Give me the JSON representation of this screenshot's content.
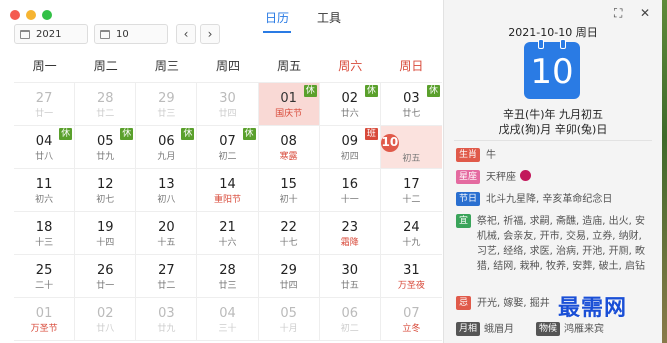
{
  "window": {
    "lights": [
      "#f45b50",
      "#f6b431",
      "#33c046"
    ]
  },
  "tabs": [
    {
      "label": "日历",
      "active": true
    },
    {
      "label": "工具",
      "active": false
    }
  ],
  "toolbar": {
    "year": "2021",
    "month": "10",
    "prev": "‹",
    "next": "›"
  },
  "weekdays": [
    {
      "label": "周一",
      "weekend": false
    },
    {
      "label": "周二",
      "weekend": false
    },
    {
      "label": "周三",
      "weekend": false
    },
    {
      "label": "周四",
      "weekend": false
    },
    {
      "label": "周五",
      "weekend": false
    },
    {
      "label": "周六",
      "weekend": true
    },
    {
      "label": "周日",
      "weekend": true
    }
  ],
  "days": [
    {
      "d": "27",
      "l": "廿一",
      "other": true
    },
    {
      "d": "28",
      "l": "廿二",
      "other": true
    },
    {
      "d": "29",
      "l": "廿三",
      "other": true
    },
    {
      "d": "30",
      "l": "廿四",
      "other": true
    },
    {
      "d": "01",
      "l": "国庆节",
      "fest": true,
      "badge": "休",
      "holiday": true
    },
    {
      "d": "02",
      "l": "廿六",
      "badge": "休"
    },
    {
      "d": "03",
      "l": "廿七",
      "badge": "休"
    },
    {
      "d": "04",
      "l": "廿八",
      "badge": "休"
    },
    {
      "d": "05",
      "l": "廿九",
      "badge": "休"
    },
    {
      "d": "06",
      "l": "九月",
      "badge": "休"
    },
    {
      "d": "07",
      "l": "初二",
      "badge": "休"
    },
    {
      "d": "08",
      "l": "寒露",
      "fest": true
    },
    {
      "d": "09",
      "l": "初四",
      "badge": "班",
      "work": true
    },
    {
      "d": "10",
      "l": "初五",
      "today": true
    },
    {
      "d": "11",
      "l": "初六"
    },
    {
      "d": "12",
      "l": "初七"
    },
    {
      "d": "13",
      "l": "初八"
    },
    {
      "d": "14",
      "l": "重阳节",
      "fest": true
    },
    {
      "d": "15",
      "l": "初十"
    },
    {
      "d": "16",
      "l": "十一"
    },
    {
      "d": "17",
      "l": "十二"
    },
    {
      "d": "18",
      "l": "十三"
    },
    {
      "d": "19",
      "l": "十四"
    },
    {
      "d": "20",
      "l": "十五"
    },
    {
      "d": "21",
      "l": "十六"
    },
    {
      "d": "22",
      "l": "十七"
    },
    {
      "d": "23",
      "l": "霜降",
      "fest": true
    },
    {
      "d": "24",
      "l": "十九"
    },
    {
      "d": "25",
      "l": "二十"
    },
    {
      "d": "26",
      "l": "廿一"
    },
    {
      "d": "27",
      "l": "廿二"
    },
    {
      "d": "28",
      "l": "廿三"
    },
    {
      "d": "29",
      "l": "廿四"
    },
    {
      "d": "30",
      "l": "廿五"
    },
    {
      "d": "31",
      "l": "万圣夜",
      "fest": true
    },
    {
      "d": "01",
      "l": "万圣节",
      "fest": true,
      "other": true
    },
    {
      "d": "02",
      "l": "廿八",
      "other": true
    },
    {
      "d": "03",
      "l": "廿九",
      "other": true
    },
    {
      "d": "04",
      "l": "三十",
      "other": true
    },
    {
      "d": "05",
      "l": "十月",
      "other": true
    },
    {
      "d": "06",
      "l": "初二",
      "other": true
    },
    {
      "d": "07",
      "l": "立冬",
      "fest": true,
      "other": true
    }
  ],
  "panel": {
    "date_line": "2021-10-10 周日",
    "big_day": "10",
    "lunar1": "辛丑(牛)年 九月初五",
    "lunar2": "戊戌(狗)月 辛卯(兔)日",
    "shengxiao_tag": "生肖",
    "shengxiao": "牛",
    "xingzuo_tag": "星座",
    "xingzuo": "天秤座",
    "jieri_tag": "节日",
    "jieri": "北斗九星降, 辛亥革命纪念日",
    "yi_tag": "宜",
    "yi": "祭祀, 祈福, 求嗣, 斋醮, 造庙, 出火, 安机械, 会亲友, 开市, 交易, 立券, 纳财, 习艺, 经络, 求医, 治病, 开池, 开厕, 畋猎, 结网, 栽种, 牧养, 安葬, 破土, 启钻",
    "ji_tag": "忌",
    "ji": "开光, 嫁娶, 掘井",
    "yueming_tag": "月相",
    "yueming": "蛾眉月",
    "wuhou_tag": "物候",
    "wuhou": "鸿雁来宾"
  },
  "watermark": "最需网"
}
